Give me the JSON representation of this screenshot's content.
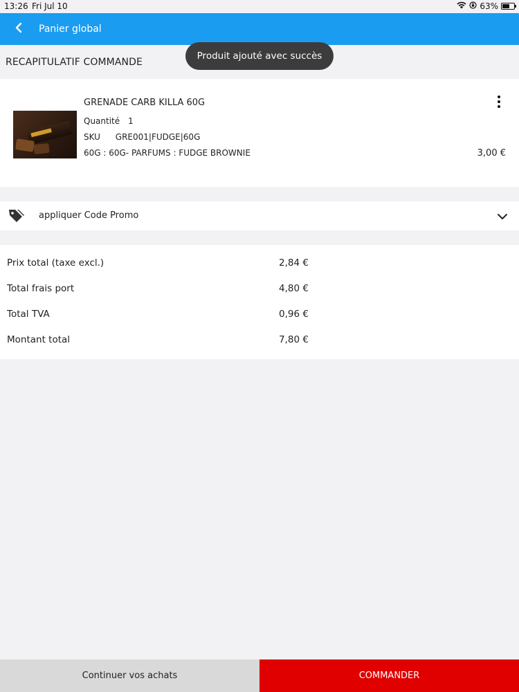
{
  "status_bar": {
    "time": "13:26",
    "date": "Fri Jul 10",
    "battery": "63%"
  },
  "header": {
    "title": "Panier global"
  },
  "summary": {
    "title": "RECAPITULATIF COMMANDE"
  },
  "toast": {
    "message": "Produit ajouté avec succès"
  },
  "product": {
    "name": "GRENADE CARB KILLA 60G",
    "quantity_label": "Quantité",
    "quantity": "1",
    "sku_label": "SKU",
    "sku": "GRE001|FUDGE|60G",
    "variant": "60G : 60G- PARFUMS : FUDGE BROWNIE",
    "price": "3,00 €"
  },
  "promo": {
    "label": "appliquer Code Promo"
  },
  "totals": [
    {
      "label": "Prix total (taxe excl.)",
      "value": "2,84 €"
    },
    {
      "label": "Total frais port",
      "value": "4,80 €"
    },
    {
      "label": "Total TVA",
      "value": "0,96 €"
    },
    {
      "label": "Montant total",
      "value": "7,80 €"
    }
  ],
  "buttons": {
    "continue": "Continuer vos achats",
    "order": "COMMANDER"
  },
  "colors": {
    "header_bg": "#1a9cf0",
    "order_button_bg": "#e00000",
    "continue_button_bg": "#d9d9d9",
    "toast_bg": "#3c3c3c"
  }
}
